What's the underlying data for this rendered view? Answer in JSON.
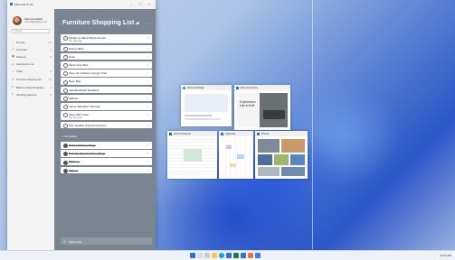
{
  "app": {
    "title": "Microsoft To Do"
  },
  "profile": {
    "name": "Samuel Haskill",
    "email": "samuel@outlook.com"
  },
  "search": {
    "placeholder": "Search"
  },
  "sidebar": {
    "items": [
      {
        "icon": "sun-icon",
        "glyph": "☼",
        "label": "My Day",
        "count": "12"
      },
      {
        "icon": "star-icon",
        "glyph": "☆",
        "label": "Important",
        "count": "3"
      },
      {
        "icon": "calendar-icon",
        "glyph": "▦",
        "label": "Planned",
        "count": "8"
      },
      {
        "icon": "person-icon",
        "glyph": "◎",
        "label": "Assigned to me",
        "count": ""
      },
      {
        "icon": "home-icon",
        "glyph": "⌂",
        "label": "Tasks",
        "count": "9"
      },
      {
        "icon": "list-icon",
        "glyph": "≡",
        "label": "Furniture shopping list",
        "count": "12"
      },
      {
        "icon": "list-icon",
        "glyph": "≡",
        "label": "Back to School Supplies",
        "count": "4"
      },
      {
        "icon": "list-icon",
        "glyph": "≡",
        "label": "Wedding planning",
        "count": "8"
      }
    ],
    "new_list": "New list"
  },
  "list": {
    "title": "Furniture Shopping List",
    "title_icon": "couch-emoji",
    "tasks": [
      {
        "name": "Modern & Sleek Wood Armoire",
        "sub": "Due Saturday"
      },
      {
        "name": "Dining Table",
        "sub": ""
      },
      {
        "name": "Desk",
        "sub": ""
      },
      {
        "name": "Sleek Gray Bed",
        "sub": ""
      },
      {
        "name": "Open Air Outdoor Lounge Chair",
        "sub": ""
      },
      {
        "name": "Bean Bag",
        "sub": ""
      },
      {
        "name": "LED Bookshelf Speakers",
        "sub": ""
      },
      {
        "name": "Wall Art",
        "sub": ""
      },
      {
        "name": "Indoor Microfiber Ottoman",
        "sub": ""
      },
      {
        "name": "Shop ART Lamp",
        "sub": "Due tomorrow"
      },
      {
        "name": "Pick Suitable Sofa Accessories",
        "sub": ""
      }
    ],
    "completed_label": "Completed",
    "completed": [
      {
        "name": "Bath & Kitchen Rugs"
      },
      {
        "name": "Pick Up Imported Area Rugs"
      },
      {
        "name": "Mattress"
      },
      {
        "name": "Pillows"
      }
    ],
    "add_task": "Add a task"
  },
  "snap": {
    "thumbs": [
      {
        "title": "Microsoft Edge",
        "icon_color": "#1aa0e6"
      },
      {
        "title": "Microsoft Store",
        "icon_color": "#2f6fd6"
      },
      {
        "title": "Microsoft Excel",
        "icon_color": "#1d7a46"
      },
      {
        "title": "Calendar",
        "icon_color": "#2f6fd6"
      },
      {
        "title": "Photos",
        "icon_color": "#2f6fd6"
      }
    ],
    "store_headline": "Experiences built to thrill"
  },
  "taskbar": {
    "clock": "11:04 AM"
  },
  "colors": {
    "list_pane": "#7a8591",
    "accent": "#2f6fd6"
  }
}
